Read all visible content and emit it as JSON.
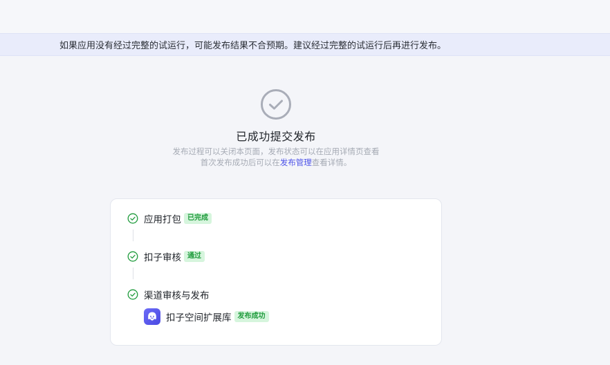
{
  "notice": {
    "text": "如果应用没有经过完整的试运行，可能发布结果不合预期。建议经过完整的试运行后再进行发布。"
  },
  "success": {
    "title": "已成功提交发布",
    "line1": "发布过程可以关闭本页面，发布状态可以在应用详情页查看",
    "line2_prefix": "首次发布成功后可以在",
    "line2_link": "发布管理",
    "line2_suffix": "查看详情。"
  },
  "steps": [
    {
      "label": "应用打包",
      "tag": "已完成"
    },
    {
      "label": "扣子审核",
      "tag": "通过"
    },
    {
      "label": "渠道审核与发布",
      "tag": ""
    }
  ],
  "channel": {
    "name": "扣子空间扩展库",
    "tag": "发布成功"
  },
  "colors": {
    "accent": "#4d53e8",
    "success": "#1f9b3c",
    "success_bg": "#d6f5dd",
    "notice_bg": "#e9ecfb",
    "check_gray": "#a9adb8"
  }
}
